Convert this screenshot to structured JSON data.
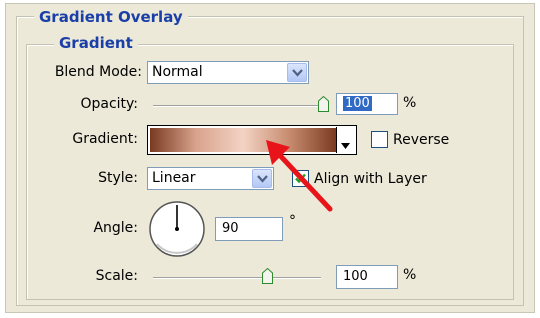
{
  "section": {
    "title": "Gradient Overlay",
    "subtitle": "Gradient"
  },
  "blend_mode": {
    "label": "Blend Mode:",
    "value": "Normal"
  },
  "opacity": {
    "label": "Opacity:",
    "value": "100",
    "unit": "%",
    "slider_fraction": 1.0
  },
  "gradient": {
    "label": "Gradient:",
    "reverse_label": "Reverse",
    "reverse_checked": false,
    "colors": [
      "#7a3a22",
      "#d9a38d",
      "#f3d3c4",
      "#c78c6f",
      "#7a3a22"
    ]
  },
  "style": {
    "label": "Style:",
    "value": "Linear",
    "align_label": "Align with Layer",
    "align_checked": true
  },
  "angle": {
    "label": "Angle:",
    "value": "90",
    "unit": "°"
  },
  "scale": {
    "label": "Scale:",
    "value": "100",
    "unit": "%",
    "slider_fraction": 0.68
  },
  "accent_color": "#1a3fa8",
  "annotation_color": "#e8141a"
}
